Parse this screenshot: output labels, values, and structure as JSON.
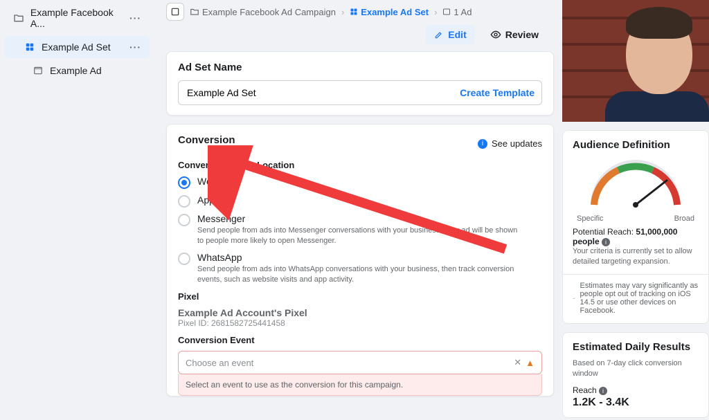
{
  "sidebar": {
    "items": [
      {
        "label": "Example Facebook A..."
      },
      {
        "label": "Example Ad Set"
      },
      {
        "label": "Example Ad"
      }
    ]
  },
  "breadcrumb": {
    "campaign": "Example Facebook Ad Campaign",
    "adset": "Example Ad Set",
    "ad": "1 Ad"
  },
  "tabs": {
    "edit": "Edit",
    "review": "Review"
  },
  "adset": {
    "name_heading": "Ad Set Name",
    "name_value": "Example Ad Set",
    "create_template": "Create Template"
  },
  "conversion": {
    "heading": "Conversion",
    "see_updates": "See updates",
    "location_heading": "Conversion Event Location",
    "options": {
      "website": "Website",
      "app": "App",
      "messenger": "Messenger",
      "messenger_desc": "Send people from ads into Messenger conversations with your business. Your ad will be shown to people more likely to open Messenger.",
      "whatsapp": "WhatsApp",
      "whatsapp_desc": "Send people from ads into WhatsApp conversations with your business, then track conversion events, such as website visits and app activity."
    },
    "pixel_heading": "Pixel",
    "pixel_name": "Example Ad Account's Pixel",
    "pixel_id": "Pixel ID: 2681582725441458",
    "event_heading": "Conversion Event",
    "event_placeholder": "Choose an event",
    "event_error": "Select an event to use as the conversion for this campaign."
  },
  "audience": {
    "heading": "Audience Definition",
    "specific": "Specific",
    "broad": "Broad",
    "potential_label": "Potential Reach:",
    "potential_value": "51,000,000 people",
    "criteria": "Your criteria is currently set to allow detailed targeting expansion.",
    "disclaimer": "Estimates may vary significantly as people opt out of tracking on iOS 14.5 or use other devices on Facebook."
  },
  "estimated": {
    "heading": "Estimated Daily Results",
    "sub": "Based on 7-day click conversion window",
    "reach_label": "Reach",
    "reach_value": "1.2K - 3.4K"
  }
}
